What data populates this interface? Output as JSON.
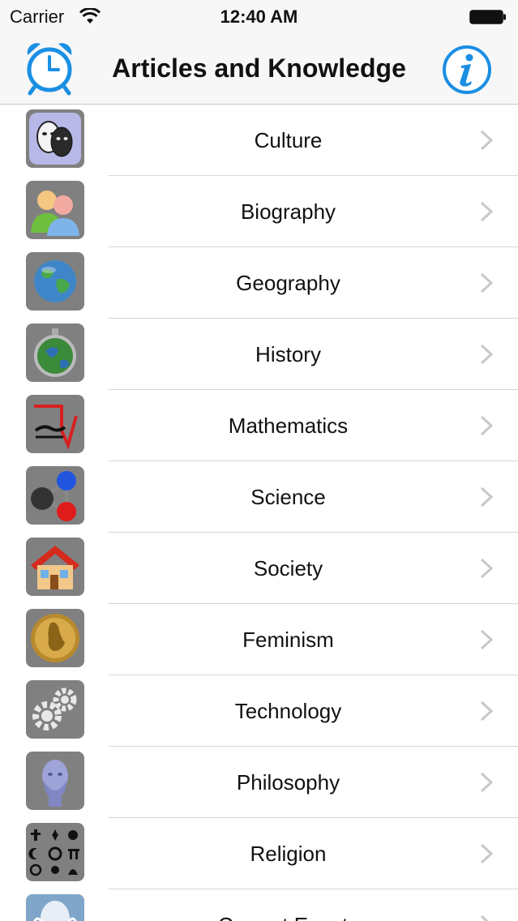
{
  "status_bar": {
    "carrier": "Carrier",
    "time": "12:40 AM"
  },
  "nav": {
    "title": "Articles and Knowledge",
    "left_icon": "alarm-clock-icon",
    "right_icon": "info-icon",
    "accent_color": "#1a8fe3"
  },
  "categories": [
    {
      "label": "Culture",
      "icon": "theater-masks-icon"
    },
    {
      "label": "Biography",
      "icon": "people-icon"
    },
    {
      "label": "Geography",
      "icon": "globe-icon"
    },
    {
      "label": "History",
      "icon": "stopwatch-globe-icon"
    },
    {
      "label": "Mathematics",
      "icon": "math-graph-icon"
    },
    {
      "label": "Science",
      "icon": "molecule-icon"
    },
    {
      "label": "Society",
      "icon": "house-icon"
    },
    {
      "label": "Feminism",
      "icon": "bronze-medal-icon"
    },
    {
      "label": "Technology",
      "icon": "gears-icon"
    },
    {
      "label": "Philosophy",
      "icon": "philosopher-bust-icon"
    },
    {
      "label": "Religion",
      "icon": "religious-symbols-icon"
    },
    {
      "label": "Current Events",
      "icon": "current-events-icon"
    }
  ]
}
